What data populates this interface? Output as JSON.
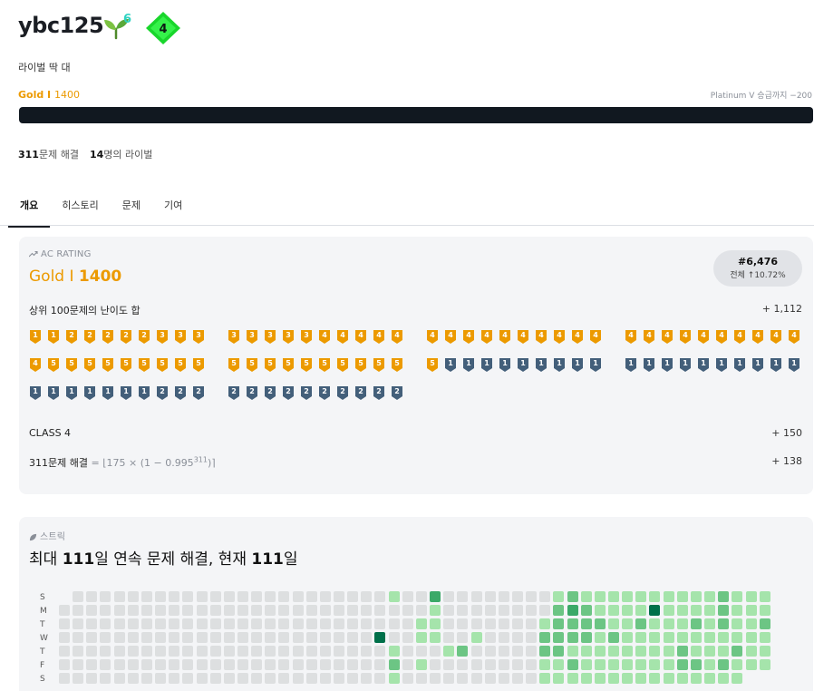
{
  "profile": {
    "handle": "ybc125",
    "sprout_count": "6",
    "tier_badge_number": "4",
    "bio": "라이벌 딱 대",
    "tier_name": "Gold I",
    "tier_rating": "1400",
    "promotion_text": "Platinum V 승급까지 −200",
    "progress_fraction": 0.0,
    "solved_count": "311",
    "solved_suffix": "문제 해결",
    "rival_count": "14",
    "rival_suffix": "명의 라이벌"
  },
  "tabs": [
    "개요",
    "히스토리",
    "문제",
    "기여"
  ],
  "ac_rating": {
    "label": "AC RATING",
    "tier": "Gold I",
    "value": "1400",
    "rank": "#6,476",
    "percentile": "전체 ↑10.72%",
    "top100_label": "상위 100문제의 난이도 합",
    "top100_points": "+ 1,112",
    "class_label": "CLASS 4",
    "class_points": "+ 150",
    "solved_label": "311문제 해결",
    "solved_formula_prefix": "= ⌊175 × (1 − 0.995",
    "solved_formula_exp": "311",
    "solved_formula_suffix": ")⌉",
    "solved_points": "+ 138"
  },
  "top100_badges": [
    "g1",
    "g1",
    "g2",
    "g2",
    "g2",
    "g2",
    "g2",
    "g3",
    "g3",
    "g3",
    "g3",
    "g3",
    "g3",
    "g3",
    "g3",
    "g4",
    "g4",
    "g4",
    "g4",
    "g4",
    "g4",
    "g4",
    "g4",
    "g4",
    "g4",
    "g4",
    "g4",
    "g4",
    "g4",
    "g4",
    "g4",
    "g4",
    "g4",
    "g4",
    "g4",
    "g4",
    "g4",
    "g4",
    "g4",
    "g4",
    "g4",
    "g5",
    "g5",
    "g5",
    "g5",
    "g5",
    "g5",
    "g5",
    "g5",
    "g5",
    "g5",
    "g5",
    "g5",
    "g5",
    "g5",
    "g5",
    "g5",
    "g5",
    "g5",
    "g5",
    "g5",
    "s1",
    "s1",
    "s1",
    "s1",
    "s1",
    "s1",
    "s1",
    "s1",
    "s1",
    "s1",
    "s1",
    "s1",
    "s1",
    "s1",
    "s1",
    "s1",
    "s1",
    "s1",
    "s1",
    "s1",
    "s1",
    "s1",
    "s1",
    "s1",
    "s1",
    "s1",
    "s2",
    "s2",
    "s2",
    "s2",
    "s2",
    "s2",
    "s2",
    "s2",
    "s2",
    "s2",
    "s2",
    "s2",
    "s2"
  ],
  "streak": {
    "label": "스트릭",
    "title_prefix": "최대 ",
    "max": "111",
    "title_mid": "일 연속 문제 해결, 현재 ",
    "current": "111",
    "title_suffix": "일",
    "day_labels": [
      "S",
      "M",
      "T",
      "W",
      "T",
      "F",
      "S"
    ],
    "weeks": [
      [
        null,
        0,
        0,
        0,
        0,
        0,
        0
      ],
      [
        0,
        0,
        0,
        0,
        0,
        0,
        0
      ],
      [
        0,
        0,
        0,
        0,
        0,
        0,
        0
      ],
      [
        0,
        0,
        0,
        0,
        0,
        0,
        0
      ],
      [
        0,
        0,
        0,
        0,
        0,
        0,
        0
      ],
      [
        0,
        0,
        0,
        0,
        0,
        0,
        0
      ],
      [
        0,
        0,
        0,
        0,
        0,
        0,
        0
      ],
      [
        0,
        0,
        0,
        0,
        0,
        0,
        0
      ],
      [
        0,
        0,
        0,
        0,
        0,
        0,
        0
      ],
      [
        0,
        0,
        0,
        0,
        0,
        0,
        0
      ],
      [
        0,
        0,
        0,
        0,
        0,
        0,
        0
      ],
      [
        0,
        0,
        0,
        0,
        0,
        0,
        0
      ],
      [
        0,
        0,
        0,
        0,
        0,
        0,
        0
      ],
      [
        0,
        0,
        0,
        0,
        0,
        0,
        0
      ],
      [
        0,
        0,
        0,
        0,
        0,
        0,
        0
      ],
      [
        0,
        0,
        0,
        0,
        0,
        0,
        0
      ],
      [
        0,
        0,
        0,
        0,
        0,
        0,
        0
      ],
      [
        0,
        0,
        0,
        0,
        0,
        0,
        0
      ],
      [
        0,
        0,
        0,
        0,
        0,
        0,
        0
      ],
      [
        0,
        0,
        0,
        0,
        0,
        0,
        0
      ],
      [
        0,
        0,
        0,
        0,
        0,
        0,
        0
      ],
      [
        0,
        0,
        0,
        0,
        0,
        0,
        0
      ],
      [
        0,
        0,
        0,
        0,
        0,
        0,
        0
      ],
      [
        0,
        0,
        0,
        4,
        0,
        0,
        0
      ],
      [
        1,
        0,
        0,
        0,
        1,
        2,
        1
      ],
      [
        0,
        0,
        0,
        0,
        0,
        0,
        0
      ],
      [
        0,
        0,
        1,
        1,
        0,
        1,
        0
      ],
      [
        3,
        1,
        1,
        1,
        0,
        0,
        0
      ],
      [
        0,
        0,
        0,
        0,
        1,
        0,
        0
      ],
      [
        0,
        0,
        0,
        0,
        2,
        0,
        0
      ],
      [
        0,
        0,
        0,
        1,
        0,
        0,
        0
      ],
      [
        0,
        0,
        0,
        0,
        0,
        0,
        0
      ],
      [
        0,
        0,
        0,
        0,
        0,
        0,
        0
      ],
      [
        0,
        0,
        0,
        0,
        0,
        0,
        0
      ],
      [
        0,
        0,
        0,
        0,
        0,
        0,
        0
      ],
      [
        0,
        0,
        1,
        2,
        2,
        1,
        1
      ],
      [
        1,
        2,
        2,
        2,
        2,
        1,
        1
      ],
      [
        2,
        3,
        2,
        2,
        1,
        2,
        1
      ],
      [
        1,
        2,
        2,
        2,
        1,
        1,
        1
      ],
      [
        1,
        1,
        2,
        1,
        1,
        1,
        1
      ],
      [
        1,
        1,
        1,
        2,
        1,
        1,
        1
      ],
      [
        1,
        1,
        1,
        1,
        1,
        1,
        1
      ],
      [
        1,
        1,
        2,
        1,
        1,
        1,
        1
      ],
      [
        1,
        4,
        1,
        1,
        1,
        1,
        1
      ],
      [
        1,
        1,
        1,
        1,
        1,
        1,
        1
      ],
      [
        1,
        1,
        1,
        1,
        2,
        2,
        1
      ],
      [
        1,
        1,
        2,
        1,
        1,
        2,
        1
      ],
      [
        1,
        1,
        1,
        1,
        1,
        1,
        1
      ],
      [
        2,
        2,
        2,
        1,
        1,
        2,
        1
      ],
      [
        1,
        1,
        1,
        1,
        2,
        1,
        1
      ],
      [
        1,
        1,
        1,
        1,
        1,
        1,
        null
      ],
      [
        1,
        1,
        2,
        1,
        1,
        1,
        null
      ]
    ]
  },
  "colors": {
    "gold": "#ec9a00",
    "silver": "#435f7a",
    "streak_levels": [
      "#dddfe0",
      "#a5e4ab",
      "#6cc584",
      "#3ba968",
      "#00704a"
    ]
  }
}
